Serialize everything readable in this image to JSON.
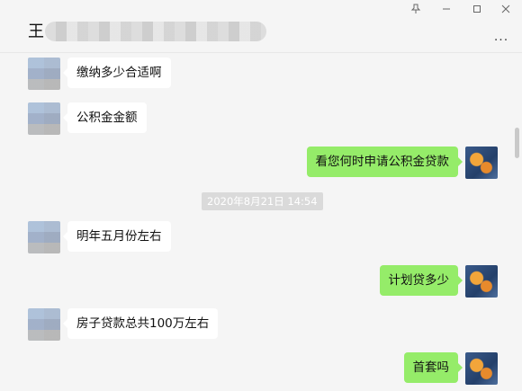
{
  "window": {
    "pin_icon": "pin-icon",
    "minimize_icon": "minimize-icon",
    "maximize_icon": "maximize-icon",
    "close_icon": "close-icon"
  },
  "chat": {
    "contact_name_visible": "王",
    "more_label": "...",
    "timestamp": "2020年8月21日 14:54",
    "messages": [
      {
        "side": "left",
        "text": "缴纳多少合适啊"
      },
      {
        "side": "left",
        "text": "公积金金额"
      },
      {
        "side": "right",
        "text": "看您何时申请公积金贷款"
      },
      {
        "side": "left",
        "text": "明年五月份左右"
      },
      {
        "side": "right",
        "text": "计划贷多少"
      },
      {
        "side": "left",
        "text": "房子贷款总共100万左右"
      },
      {
        "side": "right",
        "text": "首套吗"
      }
    ]
  },
  "colors": {
    "background": "#f5f5f5",
    "incoming_bubble": "#ffffff",
    "outgoing_bubble": "#95ec69",
    "timestamp_bg": "#dadada"
  }
}
